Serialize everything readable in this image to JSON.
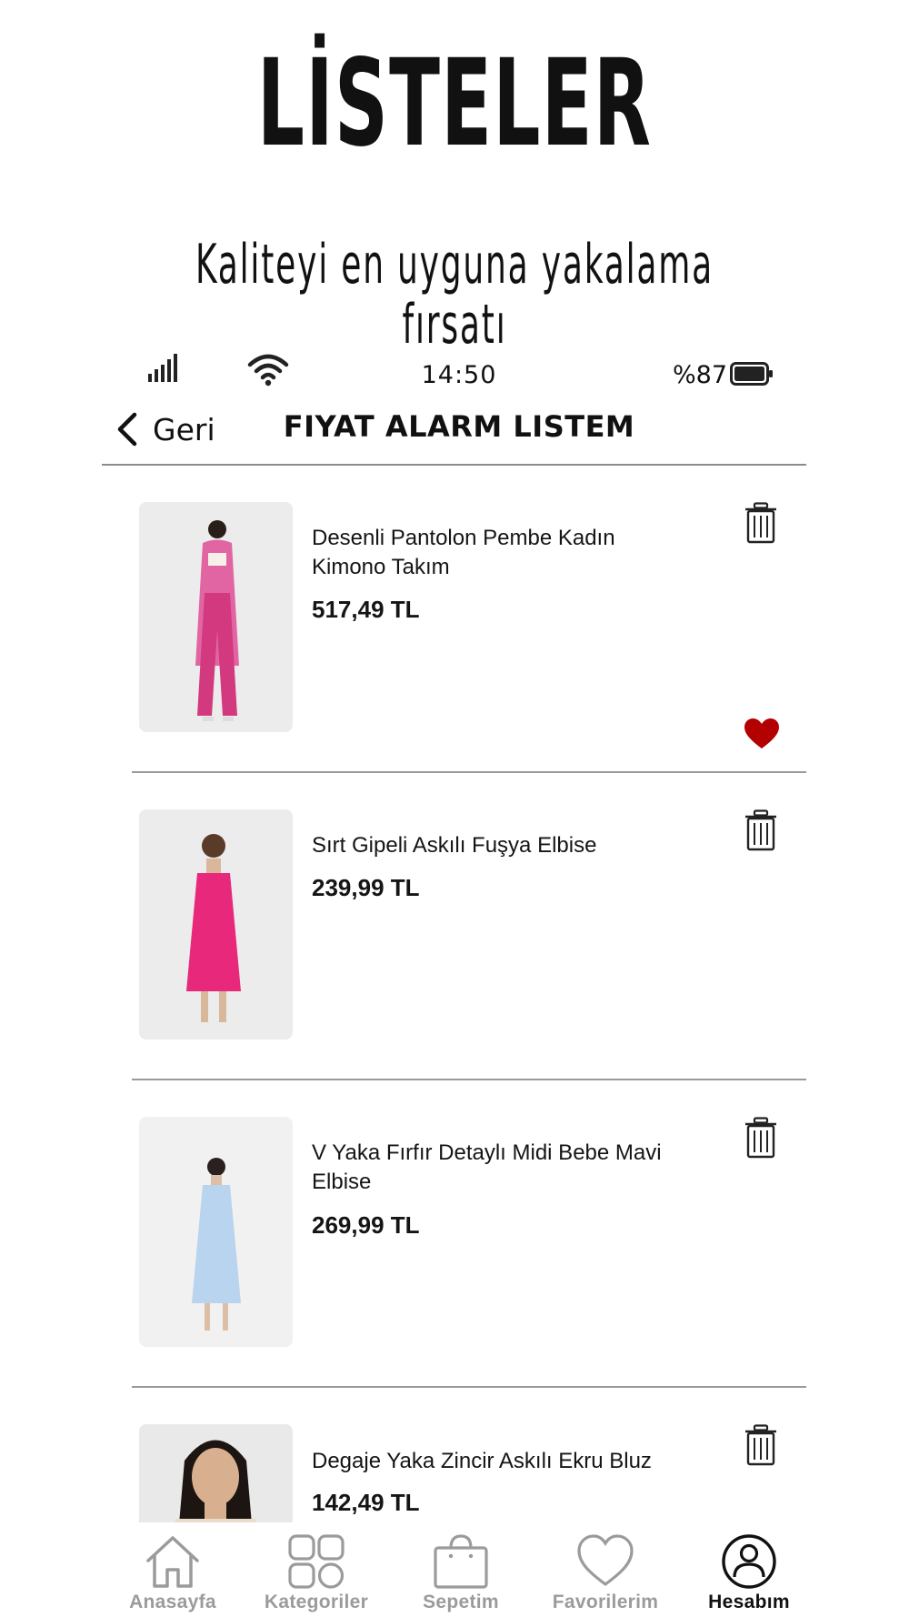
{
  "promo": {
    "title": "LİSTELER",
    "subtitle": "Kaliteyi en uyguna yakalama fırsatı"
  },
  "status_bar": {
    "time": "14:50",
    "battery": "%87"
  },
  "nav": {
    "back_label": "Geri",
    "title": "FIYAT ALARM LISTEM"
  },
  "items": [
    {
      "name": "Desenli Pantolon Pembe Kadın Kimono Takım",
      "price": "517,49 TL",
      "favorited": true,
      "dress_color": "#e04d96"
    },
    {
      "name": "Sırt Gipeli Askılı Fuşya Elbise",
      "price": "239,99 TL",
      "favorited": false,
      "dress_color": "#e8287a"
    },
    {
      "name": "V Yaka Fırfır Detaylı Midi Bebe Mavi Elbise",
      "price": "269,99 TL",
      "favorited": false,
      "dress_color": "#b9d4ee"
    },
    {
      "name": "Degaje Yaka Zincir Askılı Ekru Bluz",
      "price": "142,49 TL",
      "favorited": false,
      "dress_color": "#e9dccb"
    }
  ],
  "tabs": [
    {
      "label": "Anasayfa",
      "icon": "home-icon",
      "active": false
    },
    {
      "label": "Kategoriler",
      "icon": "categories-icon",
      "active": false
    },
    {
      "label": "Sepetim",
      "icon": "bag-icon",
      "active": false
    },
    {
      "label": "Favorilerim",
      "icon": "heart-icon",
      "active": false
    },
    {
      "label": "Hesabım",
      "icon": "account-icon",
      "active": true
    }
  ],
  "colors": {
    "favorite_heart": "#b30000",
    "inactive_tab": "#9b9b9b",
    "active_tab": "#111111"
  }
}
